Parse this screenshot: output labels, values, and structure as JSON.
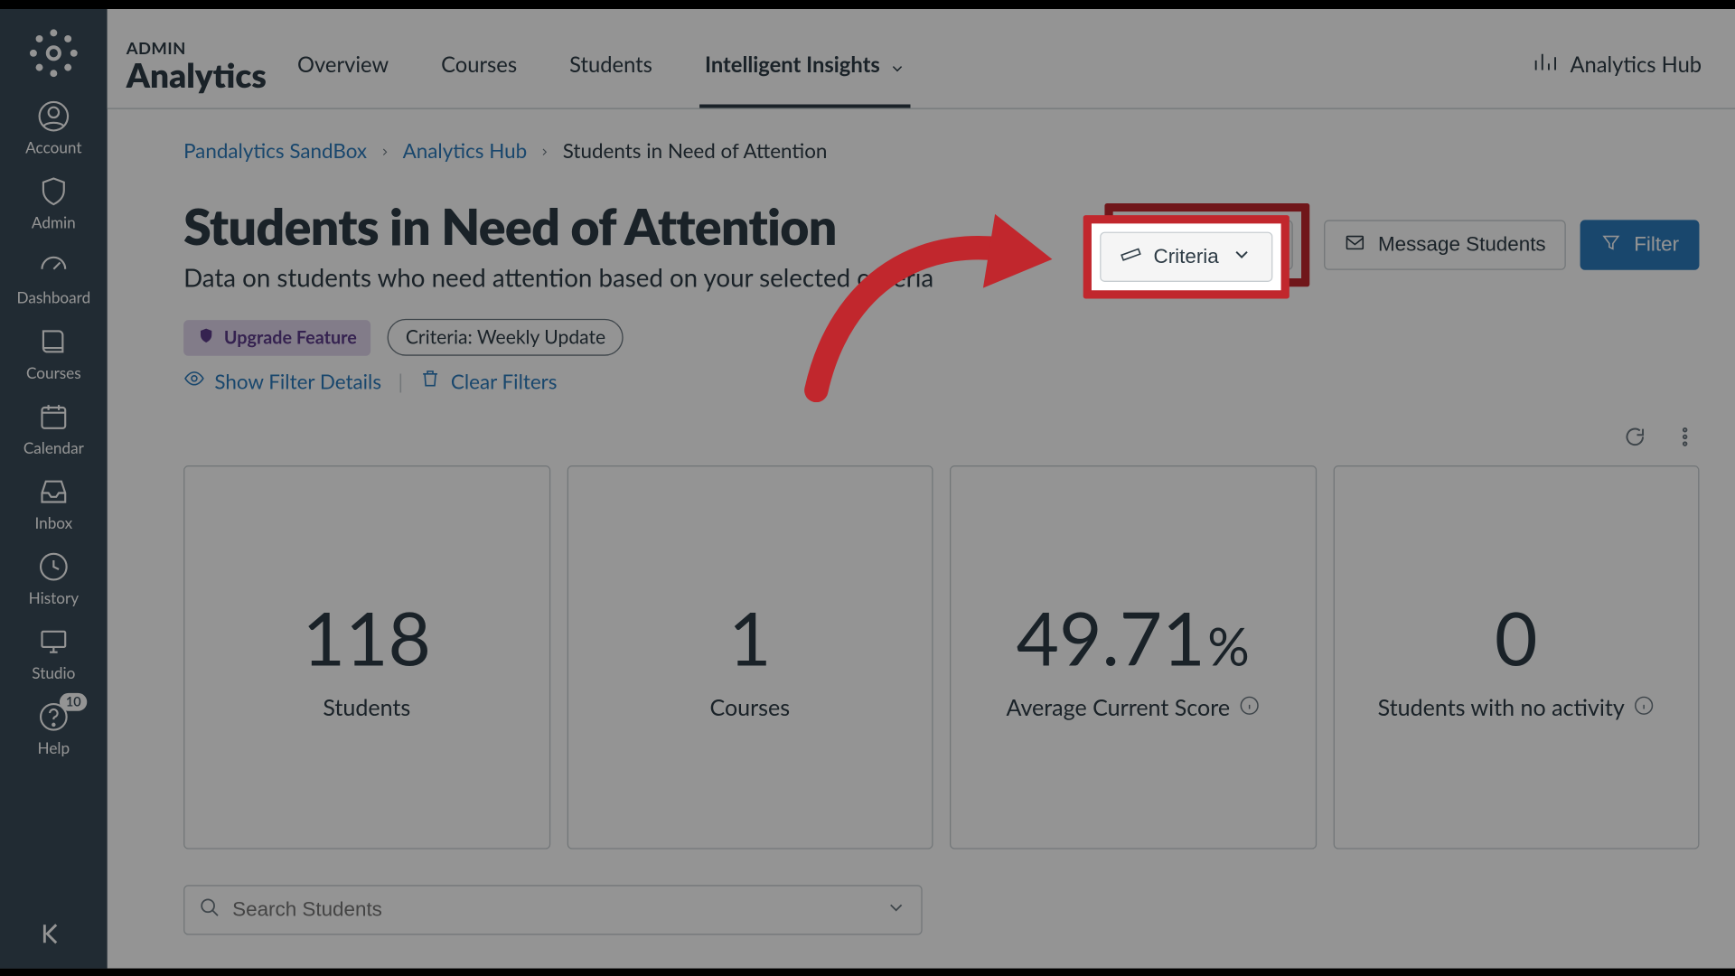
{
  "rail": {
    "items": [
      {
        "label": "Account",
        "icon": "user"
      },
      {
        "label": "Admin",
        "icon": "shield"
      },
      {
        "label": "Dashboard",
        "icon": "gauge"
      },
      {
        "label": "Courses",
        "icon": "book"
      },
      {
        "label": "Calendar",
        "icon": "calendar"
      },
      {
        "label": "Inbox",
        "icon": "inbox"
      },
      {
        "label": "History",
        "icon": "clock"
      },
      {
        "label": "Studio",
        "icon": "studio"
      },
      {
        "label": "Help",
        "icon": "help",
        "badge": "10"
      }
    ]
  },
  "header": {
    "super": "ADMIN",
    "title": "Analytics",
    "tabs": [
      {
        "label": "Overview"
      },
      {
        "label": "Courses"
      },
      {
        "label": "Students"
      },
      {
        "label": "Intelligent Insights",
        "active": true,
        "dropdown": true
      }
    ],
    "hub": "Analytics Hub"
  },
  "breadcrumbs": [
    {
      "label": "Pandalytics SandBox",
      "link": true
    },
    {
      "label": "Analytics Hub",
      "link": true
    },
    {
      "label": "Students in Need of Attention",
      "link": false
    }
  ],
  "page": {
    "title": "Students in Need of Attention",
    "subtitle": "Data on students who need attention based on your selected criteria"
  },
  "actions": {
    "criteria": "Criteria",
    "message": "Message Students",
    "filter": "Filter"
  },
  "chips": {
    "upgrade": "Upgrade Feature",
    "criteria": "Criteria: Weekly Update"
  },
  "filterline": {
    "show": "Show Filter Details",
    "clear": "Clear Filters"
  },
  "cards": [
    {
      "value": "118",
      "caption": "Students",
      "info": false
    },
    {
      "value": "1",
      "caption": "Courses",
      "info": false
    },
    {
      "value": "49.71",
      "unit": "%",
      "caption": "Average Current Score",
      "info": true
    },
    {
      "value": "0",
      "caption": "Students with no activity",
      "info": true
    }
  ],
  "search": {
    "placeholder": "Search Students"
  },
  "annotation": {
    "highlight_color": "#C1272D"
  }
}
